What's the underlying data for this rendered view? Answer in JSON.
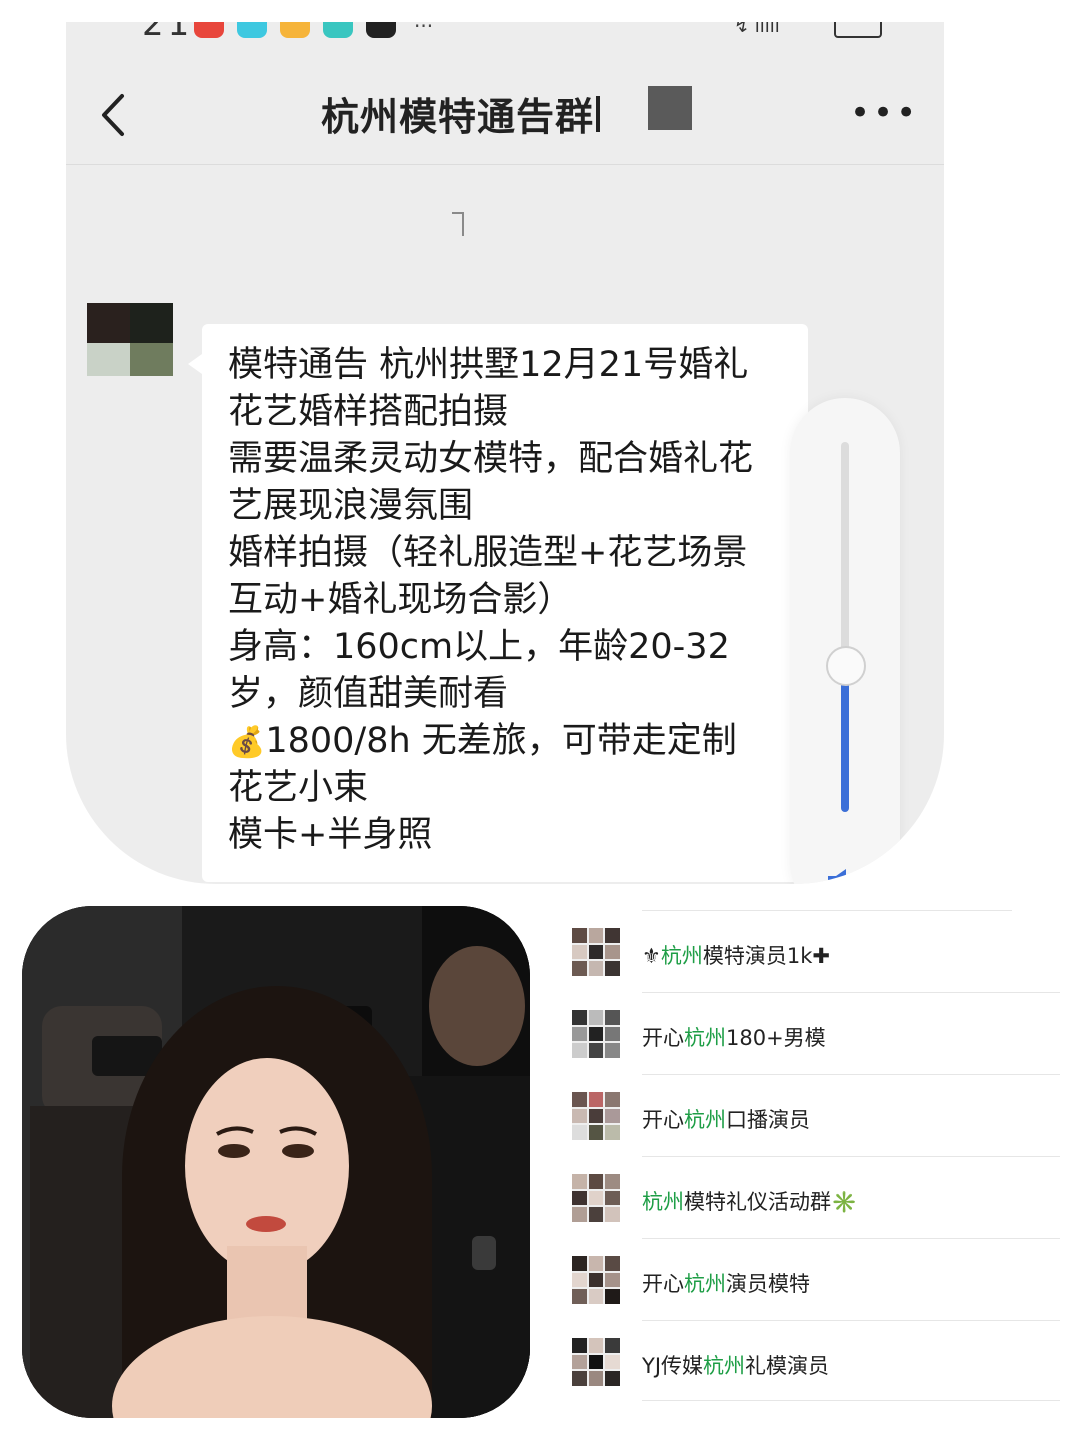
{
  "status_bar": {
    "time": "21",
    "app_icons": [
      {
        "name": "phone-missed-icon",
        "color": "#e8463c"
      },
      {
        "name": "app-cyan-icon",
        "color": "#3ec8e0"
      },
      {
        "name": "chat-yellow-icon",
        "color": "#f6b43a"
      },
      {
        "name": "app-teal-icon",
        "color": "#39c6c0"
      },
      {
        "name": "soul-icon",
        "color": "#222222"
      }
    ],
    "overflow": "...",
    "right": "↯ ıılll"
  },
  "chat": {
    "title": "杭州模特通告群",
    "message_lines": [
      "模特通告 杭州拱墅12月21号婚礼",
      "花艺婚样搭配拍摄",
      "需要温柔灵动女模特，配合婚礼花",
      "艺展现浪漫氛围",
      "婚样拍摄（轻礼服造型+花艺场景",
      "互动+婚礼现场合影）",
      "身高：160cm以上，年龄20-32",
      "岁，颜值甜美耐看",
      "1800/8h 无差旅，可带走定制",
      "花艺小束",
      "模卡+半身照"
    ],
    "money_emoji": "💰",
    "volume_level": 0.4
  },
  "groups": [
    {
      "prefix": "⚜",
      "highlight": "杭州",
      "rest": "模特演员1k✚"
    },
    {
      "prefix": "开心",
      "highlight": "杭州",
      "rest": "180+男模"
    },
    {
      "prefix": "开心",
      "highlight": "杭州",
      "rest": "口播演员"
    },
    {
      "prefix": "",
      "highlight": "杭州",
      "rest": "模特礼仪活动群✳️"
    },
    {
      "prefix": "开心",
      "highlight": "杭州",
      "rest": "演员模特"
    },
    {
      "prefix": "YJ传媒",
      "highlight": "杭州",
      "rest": "礼模演员"
    }
  ]
}
